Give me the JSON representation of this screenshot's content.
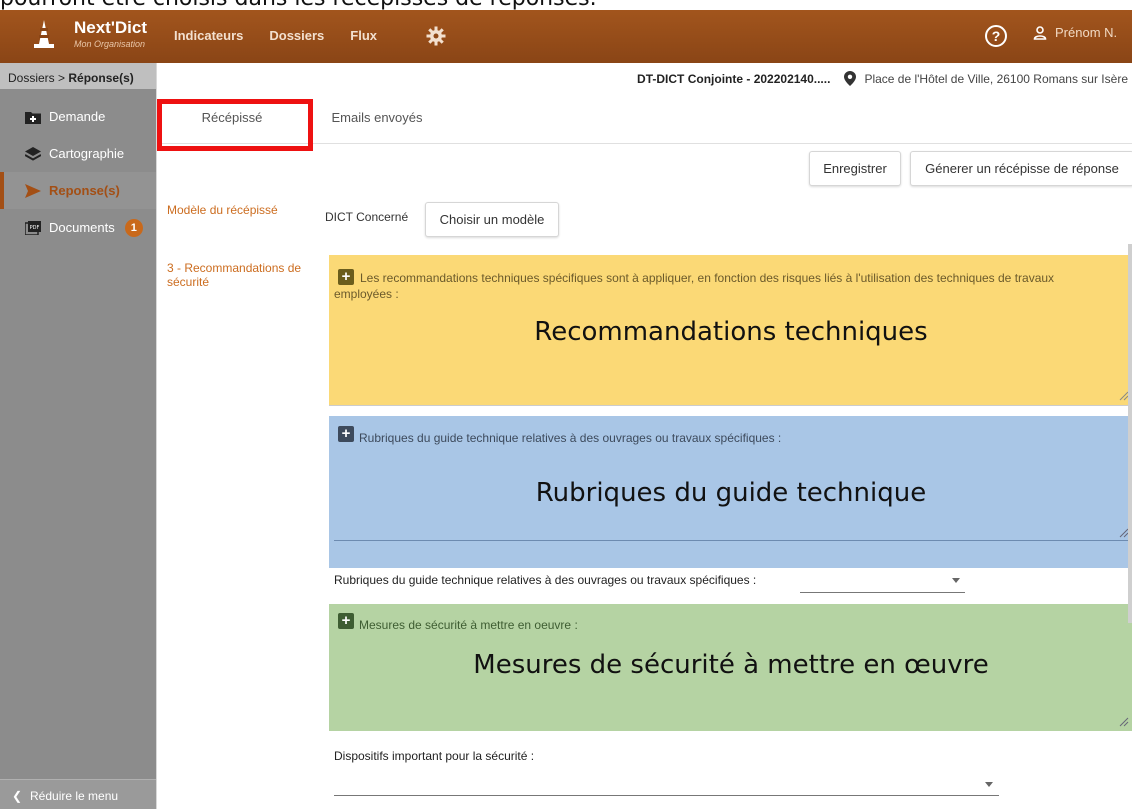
{
  "caption": {
    "text": "pourront être choisis dans les récépissés de réponses."
  },
  "topbar": {
    "brand_name": "Next'Dict",
    "brand_org": "Mon Organisation",
    "nav": [
      "Indicateurs",
      "Dossiers",
      "Flux"
    ],
    "user": "Prénom N.",
    "icons": [
      "cone-logo-icon",
      "gear-icon",
      "help-icon",
      "user-icon"
    ]
  },
  "sidebar": {
    "breadcrumb_root": "Dossiers",
    "breadcrumb_sep": ">",
    "breadcrumb_current": "Réponse(s)",
    "items": [
      {
        "label": "Demande",
        "icon": "folder-plus-icon"
      },
      {
        "label": "Cartographie",
        "icon": "layers-icon"
      },
      {
        "label": "Reponse(s)",
        "icon": "send-icon",
        "active": true
      },
      {
        "label": "Documents",
        "icon": "pdf-icon",
        "badge": "1"
      }
    ],
    "collapse_label": "Réduire le menu",
    "accent": "#a34f15"
  },
  "main": {
    "document_title": "DT-DICT Conjointe - 202202140.....",
    "address": "Place de l'Hôtel de Ville, 26100 Romans sur Isère",
    "tabs": [
      "Récépissé",
      "Emails envoyés"
    ],
    "buttons": {
      "save": "Enregistrer",
      "generate": "Génerer un récépisse de réponse",
      "choose_model": "Choisir un modèle"
    },
    "model_label": "Modèle du récépissé",
    "dict_label": "DICT Concerné",
    "section_label": "3 - Recommandations de sécurité",
    "panels": [
      {
        "desc": "Les recommandations techniques spécifiques sont à appliquer, en fonction des risques liés à l'utilisation des techniques de travaux employées :",
        "overlay": "Recommandations techniques",
        "color": "#fbd976"
      },
      {
        "desc": "Rubriques du guide technique relatives à des ouvrages ou travaux spécifiques :",
        "overlay": "Rubriques du guide technique",
        "color": "#a9c6e6"
      },
      {
        "desc": "Mesures de sécurité à mettre en oeuvre :",
        "overlay": "Mesures de sécurité à mettre en œuvre",
        "color": "#b5d3a3"
      }
    ],
    "select1_label": "Rubriques du guide technique relatives à des ouvrages ou travaux spécifiques :",
    "select2_label": "Dispositifs important pour la sécurité :"
  }
}
